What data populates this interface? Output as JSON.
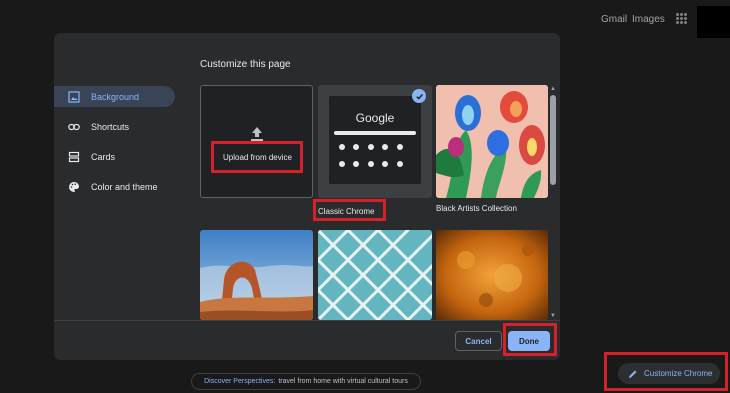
{
  "topbar": {
    "gmail": "Gmail",
    "images": "Images",
    "apps_icon": "apps-grid-icon"
  },
  "dialog": {
    "title": "Customize this page",
    "sidebar": [
      {
        "label": "Background",
        "icon": "background-image-icon",
        "active": true
      },
      {
        "label": "Shortcuts",
        "icon": "link-icon",
        "active": false
      },
      {
        "label": "Cards",
        "icon": "cards-icon",
        "active": false
      },
      {
        "label": "Color and theme",
        "icon": "palette-icon",
        "active": false
      }
    ],
    "tiles": {
      "upload": {
        "label": "Upload from device",
        "icon": "upload-icon"
      },
      "classic": {
        "label": "Classic Chrome",
        "preview_logo": "Google",
        "selected": true
      },
      "collection1": {
        "label": "Black Artists Collection"
      }
    },
    "buttons": {
      "cancel": "Cancel",
      "done": "Done"
    }
  },
  "footer": {
    "discover_highlight": "Discover Perspectives:",
    "discover_rest": "travel from home with virtual cultural tours",
    "customize_chrome": "Customize Chrome"
  },
  "colors": {
    "accent": "#8ab4f8",
    "highlight_box": "#d6202a",
    "dialog_bg": "#2a2b2d"
  }
}
